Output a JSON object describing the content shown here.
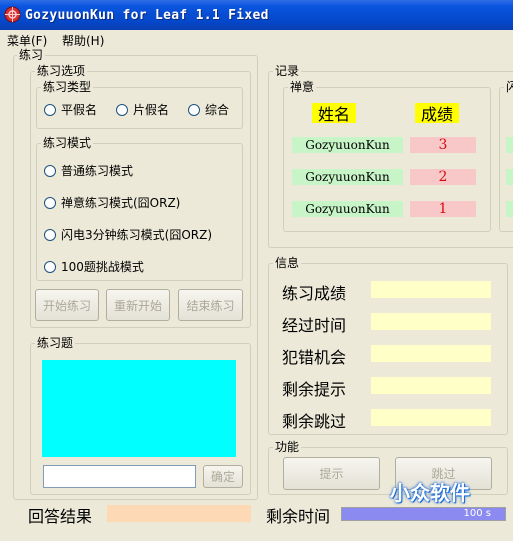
{
  "window": {
    "title": "GozyuuonKun for Leaf 1.1 Fixed"
  },
  "menu": {
    "items": [
      "菜单(F)",
      "帮助(H)"
    ]
  },
  "practice": {
    "title": "练习",
    "options": {
      "title": "练习选项",
      "type_group": {
        "title": "练习类型",
        "radios": [
          "平假名",
          "片假名",
          "综合"
        ]
      },
      "mode_group": {
        "title": "练习模式",
        "radios": [
          "普通练习模式",
          "禅意练习模式(囧ORZ)",
          "闪电3分钟练习模式(囧ORZ)",
          "100题挑战模式"
        ]
      },
      "buttons": {
        "start": "开始练习",
        "restart": "重新开始",
        "end": "结束练习"
      }
    },
    "question": {
      "title": "练习题",
      "confirm": "确定",
      "input_value": ""
    }
  },
  "record": {
    "title": "记录",
    "zen": {
      "title": "禅意",
      "header_name": "姓名",
      "header_score": "成绩",
      "rows": [
        {
          "name": "GozyuuonKun",
          "score": "3"
        },
        {
          "name": "GozyuuonKun",
          "score": "2"
        },
        {
          "name": "GozyuuonKun",
          "score": "1"
        }
      ]
    },
    "flash_title_partial": "闪"
  },
  "info": {
    "title": "信息",
    "labels": [
      "练习成绩",
      "经过时间",
      "犯错机会",
      "剩余提示",
      "剩余跳过"
    ]
  },
  "functions": {
    "title": "功能",
    "hint": "提示",
    "skip": "跳过"
  },
  "footer": {
    "answer_label": "回答结果",
    "time_label": "剩余时间",
    "time_value": "100 s",
    "time_progress": 1.0
  },
  "watermark": "小众软件",
  "colors": {
    "title_bar": "#0a55e0",
    "question_display": "#00ffff",
    "name_cell": "#c8f5c8",
    "score_cell": "#f8c8c8",
    "header_highlight": "#ffff00",
    "info_field": "#ffffc8",
    "answer_field": "#fdd9b5",
    "progress_bar": "#8a8af0"
  }
}
